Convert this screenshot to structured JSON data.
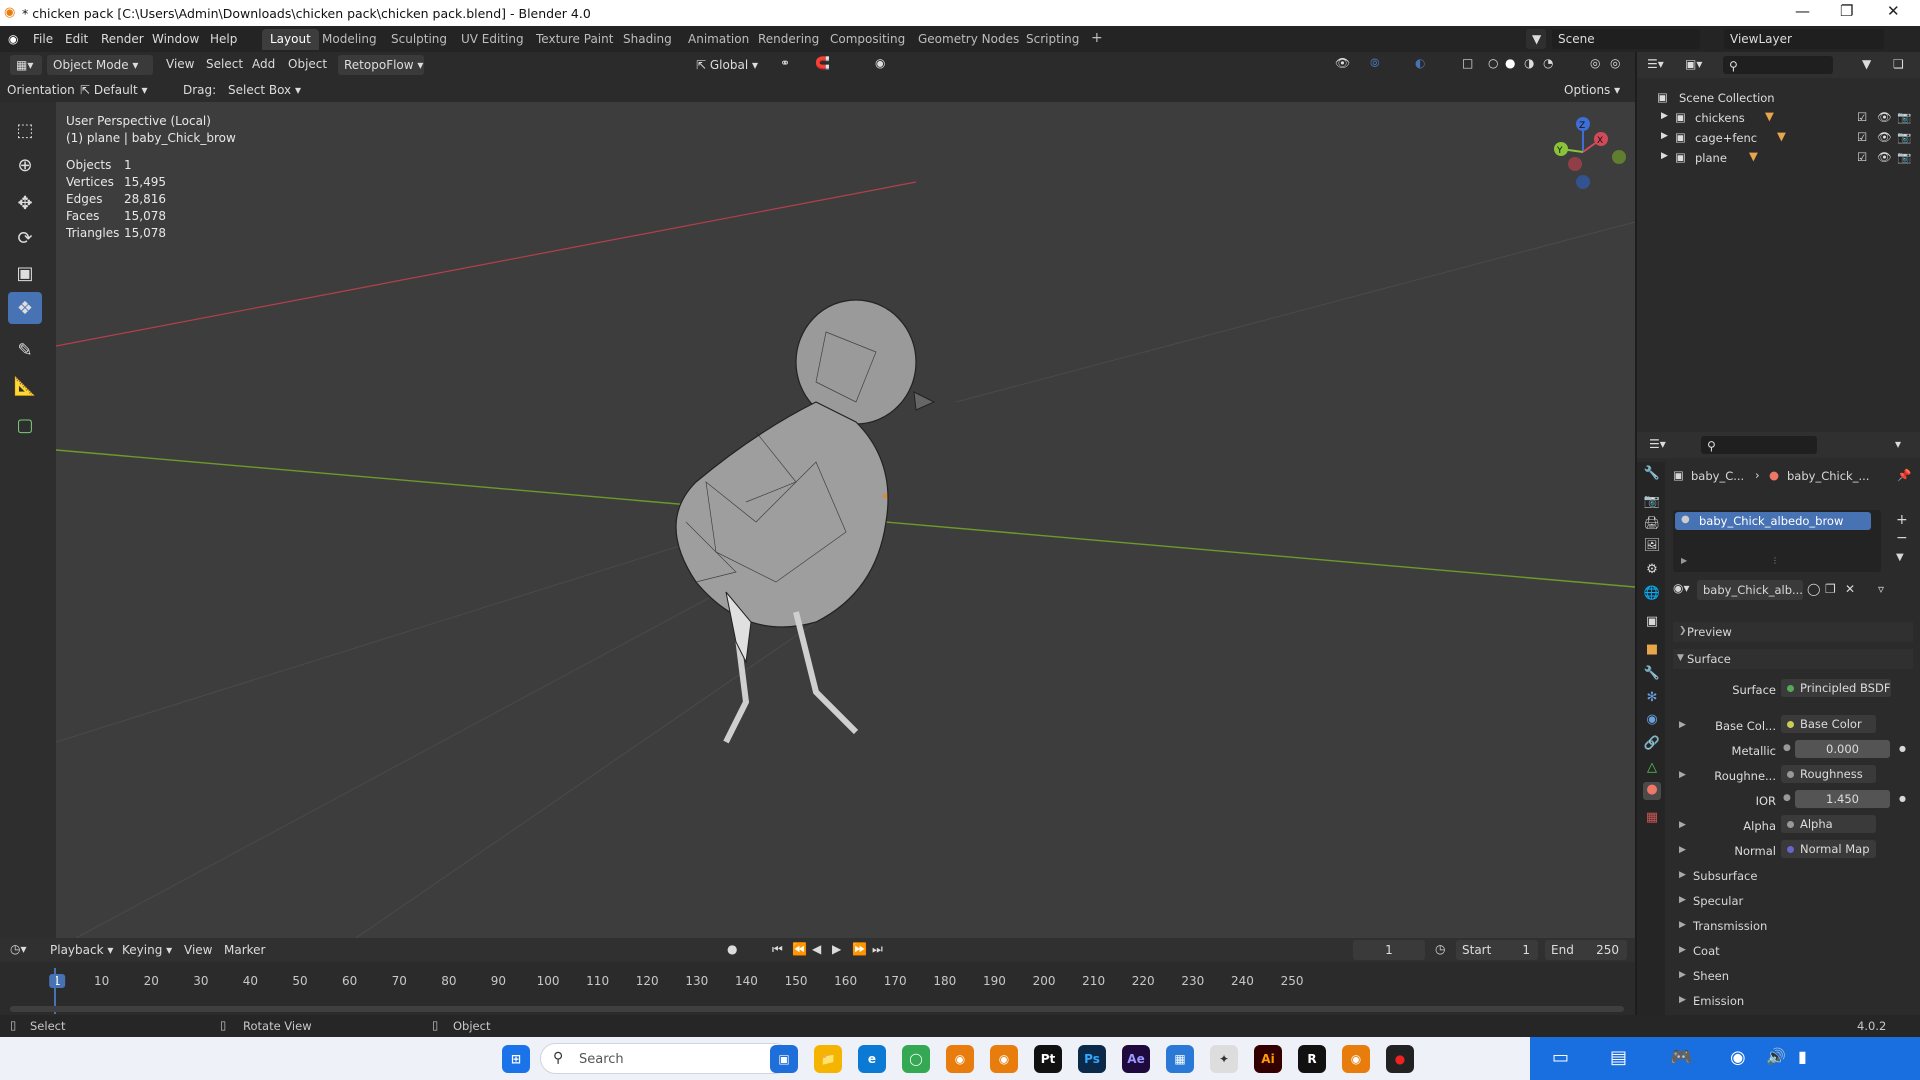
{
  "window": {
    "title": "* chicken pack [C:\\Users\\Admin\\Downloads\\chicken pack\\chicken pack.blend] - Blender 4.0",
    "minimize": "—",
    "maximize": "❐",
    "close": "✕"
  },
  "menu": {
    "items": [
      "File",
      "Edit",
      "Render",
      "Window",
      "Help"
    ],
    "workspaces": [
      "Layout",
      "Modeling",
      "Sculpting",
      "UV Editing",
      "Texture Paint",
      "Shading",
      "Animation",
      "Rendering",
      "Compositing",
      "Geometry Nodes",
      "Scripting"
    ],
    "add_workspace": "+",
    "scene": "Scene",
    "view_layer": "ViewLayer"
  },
  "viewport_header": {
    "mode": "Object Mode",
    "menus": [
      "View",
      "Select",
      "Add",
      "Object"
    ],
    "addon": "RetopoFlow",
    "transform": "Global",
    "orientation_label": "Orientation:",
    "orientation": "Default",
    "drag_label": "Drag:",
    "drag": "Select Box",
    "options": "Options"
  },
  "overlay": {
    "view_name": "User Perspective (Local)",
    "object_name": "(1) plane | baby_Chick_brow",
    "stats": [
      {
        "label": "Objects",
        "value": "1"
      },
      {
        "label": "Vertices",
        "value": "15,495"
      },
      {
        "label": "Edges",
        "value": "28,816"
      },
      {
        "label": "Faces",
        "value": "15,078"
      },
      {
        "label": "Triangles",
        "value": "15,078"
      }
    ],
    "gizmo_axes": {
      "x": "X",
      "y": "Y",
      "z": "Z"
    }
  },
  "outliner": {
    "root": "Scene Collection",
    "items": [
      {
        "name": "chickens"
      },
      {
        "name": "cage+fenc"
      },
      {
        "name": "plane"
      }
    ]
  },
  "properties": {
    "breadcrumb": [
      "baby_C...",
      "baby_Chick_..."
    ],
    "material_slot": "baby_Chick_albedo_brow",
    "material_name": "baby_Chick_alb...",
    "sections": {
      "preview": "Preview",
      "surface": "Surface"
    },
    "surface_row": {
      "label": "Surface",
      "value": "Principled BSDF"
    },
    "inputs": [
      {
        "label": "Base Col...",
        "value": "Base Color",
        "kind": "link"
      },
      {
        "label": "Metallic",
        "value": "0.000",
        "kind": "num"
      },
      {
        "label": "Roughne...",
        "value": "Roughness",
        "kind": "link"
      },
      {
        "label": "IOR",
        "value": "1.450",
        "kind": "num"
      },
      {
        "label": "Alpha",
        "value": "Alpha",
        "kind": "link"
      },
      {
        "label": "Normal",
        "value": "Normal Map",
        "kind": "link"
      }
    ],
    "subsections": [
      "Subsurface",
      "Specular",
      "Transmission",
      "Coat",
      "Sheen",
      "Emission"
    ]
  },
  "timeline": {
    "menus": [
      "Playback",
      "Keying",
      "View",
      "Marker"
    ],
    "current_frame": "1",
    "start_label": "Start",
    "start": "1",
    "end_label": "End",
    "end": "250",
    "ticks": [
      "1",
      "10",
      "20",
      "30",
      "40",
      "50",
      "60",
      "70",
      "80",
      "90",
      "100",
      "110",
      "120",
      "130",
      "140",
      "150",
      "160",
      "170",
      "180",
      "190",
      "200",
      "210",
      "220",
      "230",
      "240",
      "250"
    ]
  },
  "statusbar": {
    "select": "Select",
    "rotate": "Rotate View",
    "object": "Object",
    "version": "4.0.2"
  },
  "taskbar": {
    "search": "Search"
  },
  "colors": {
    "accent": "#4772b3",
    "viewport": "#3d3d3d",
    "x_axis": "#b3404c",
    "y_axis": "#6d9a2a"
  }
}
